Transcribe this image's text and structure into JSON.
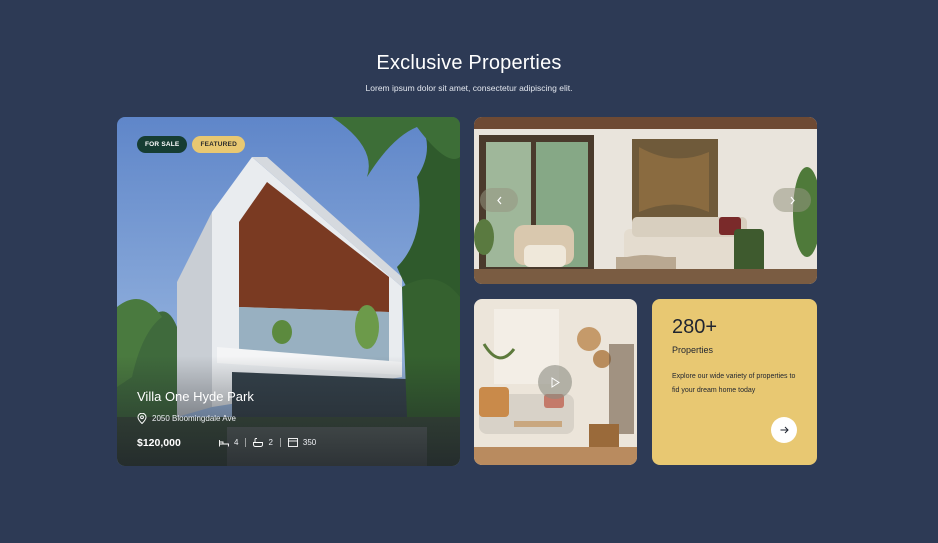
{
  "header": {
    "title": "Exclusive Properties",
    "subtitle": "Lorem ipsum dolor sit amet, consectetur adipiscing elit."
  },
  "featured": {
    "badges": [
      "FOR SALE",
      "FEATURED"
    ],
    "title": "Villa One Hyde Park",
    "address": "2050 Bloomingdale Ave",
    "price": "$120,000",
    "beds": "4",
    "baths": "2",
    "area": "350"
  },
  "stats": {
    "count": "280+",
    "label": "Properties",
    "description": "Explore our wide variety of properties to fid your dream home today"
  },
  "icons": {
    "location": "location-pin-icon",
    "bed": "bed-icon",
    "bath": "bath-icon",
    "area": "area-icon",
    "prev": "chevron-left-icon",
    "next": "chevron-right-icon",
    "play": "play-icon",
    "arrow": "arrow-right-icon"
  },
  "colors": {
    "background": "#2d3a55",
    "sale_badge": "#163d32",
    "featured_badge": "#e8c872",
    "stats_card": "#e8c872"
  }
}
